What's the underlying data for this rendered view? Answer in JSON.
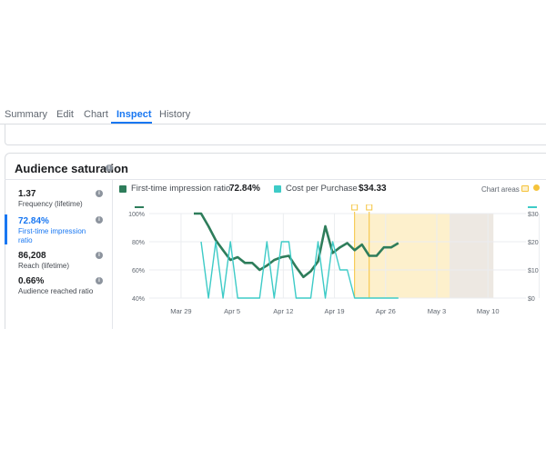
{
  "tabs": [
    {
      "label": "Summary"
    },
    {
      "label": "Edit"
    },
    {
      "label": "Chart"
    },
    {
      "label": "Inspect"
    },
    {
      "label": "History"
    }
  ],
  "card": {
    "title": "Audience saturation"
  },
  "metrics": [
    {
      "value": "1.37",
      "label": "Frequency (lifetime)"
    },
    {
      "value": "72.84%",
      "label": "First-time impression ratio"
    },
    {
      "value": "86,208",
      "label": "Reach (lifetime)"
    },
    {
      "value": "0.66%",
      "label": "Audience reached ratio"
    }
  ],
  "legend": {
    "series1": {
      "name": "First-time impression ratio",
      "value": "72.84%",
      "color": "#2e7d5b"
    },
    "series2": {
      "name": "Cost per Purchase",
      "value": "$34.33",
      "color": "#3ecbc7"
    },
    "chart_areas_label": "Chart areas"
  },
  "chart_data": {
    "type": "line",
    "x_tick_labels": [
      "Mar 29",
      "Apr 5",
      "Apr 12",
      "Apr 19",
      "Apr 26",
      "May 3",
      "May 10"
    ],
    "y_left_ticks": [
      "100%",
      "80%",
      "60%",
      "40%"
    ],
    "y_right_ticks": [
      "$30",
      "$20",
      "$10",
      "$0"
    ],
    "y_left_range": [
      40,
      100
    ],
    "y_right_range": [
      0,
      30
    ],
    "series": [
      {
        "name": "First-time impression ratio",
        "axis": "left",
        "color": "#2e7d5b",
        "values": [
          100,
          100,
          91,
          81,
          74,
          67,
          69,
          65,
          65,
          60,
          63,
          67,
          69,
          70,
          62,
          55,
          59,
          66,
          91,
          72,
          76,
          79,
          74,
          78,
          70,
          70,
          76,
          76,
          79
        ]
      },
      {
        "name": "Cost per Purchase",
        "axis": "right",
        "color": "#3ecbc7",
        "values": [
          20,
          0,
          20,
          0,
          20,
          0,
          0,
          0,
          0,
          20,
          0,
          20,
          20,
          0,
          0,
          0,
          20,
          0,
          20,
          10,
          10,
          0,
          0,
          0,
          0,
          0,
          0,
          0
        ]
      }
    ],
    "x_start_index": 0,
    "series2_start_index": 1,
    "shaded_regions": [
      {
        "from_index": 22,
        "to_index": 35,
        "color": "#fdf0cc"
      },
      {
        "from_index": 35,
        "to_index": 41,
        "color": "#ede8e2"
      }
    ],
    "markers": [
      {
        "index": 22,
        "axis": "top"
      },
      {
        "index": 24,
        "axis": "top"
      }
    ],
    "grid": true
  }
}
